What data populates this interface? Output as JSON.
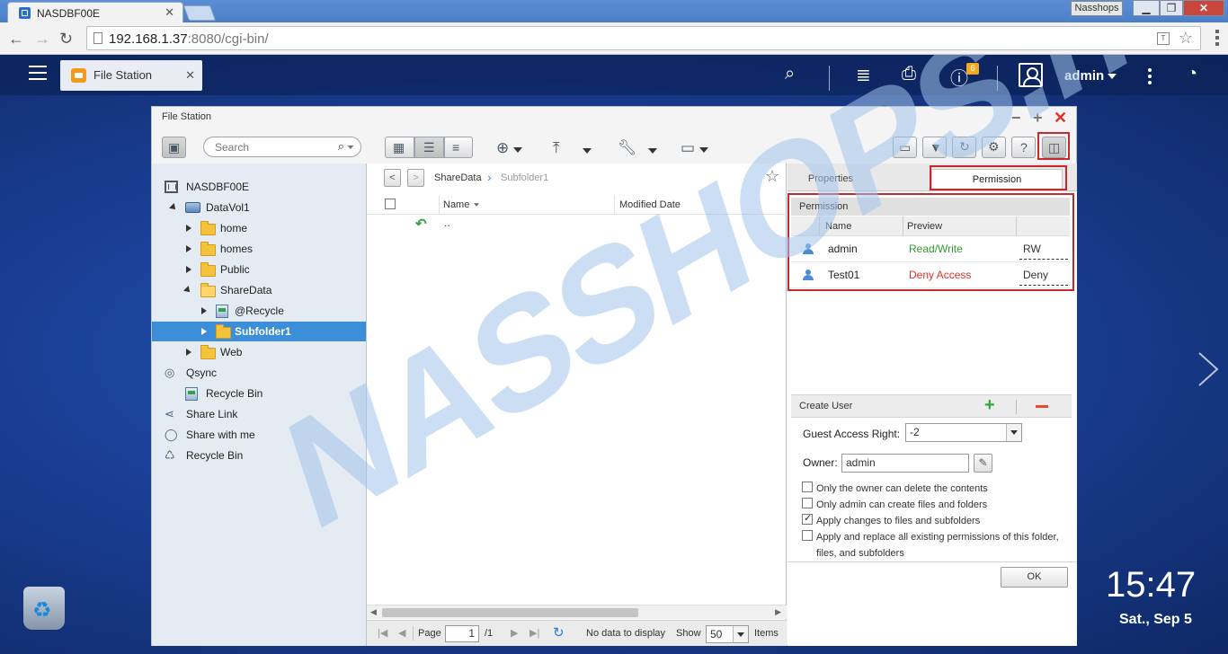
{
  "browser": {
    "tab_title": "NASDBF00E",
    "window_label": "Nasshops",
    "url_host": "192.168.1.37",
    "url_rest": ":8080/cgi-bin/"
  },
  "topbar": {
    "app_tab_label": "File Station",
    "notification_count": "6",
    "username": "admin"
  },
  "window": {
    "title": "File Station",
    "search_placeholder": "Search"
  },
  "tree": {
    "root": "NASDBF00E",
    "volume": "DataVol1",
    "folders": [
      "home",
      "homes",
      "Public",
      "ShareData"
    ],
    "sharedata_children": [
      "@Recycle",
      "Subfolder1"
    ],
    "web": "Web",
    "qsync": "Qsync",
    "qsync_recycle": "Recycle Bin",
    "share_link": "Share Link",
    "share_with_me": "Share with me",
    "recycle_bin": "Recycle Bin"
  },
  "filelist": {
    "breadcrumb": [
      "ShareData",
      "Subfolder1"
    ],
    "col_name": "Name",
    "col_modified": "Modified Date",
    "parent_entry": "..",
    "pager": {
      "page_label": "Page",
      "page_value": "1",
      "page_total": "/1",
      "status": "No data to display",
      "show_label": "Show",
      "show_value": "50",
      "items_label": "Items"
    }
  },
  "properties": {
    "tab_properties": "Properties",
    "tab_permission": "Permission",
    "section_title": "Permission",
    "col_name": "Name",
    "col_preview": "Preview",
    "rows": [
      {
        "name": "admin",
        "preview": "Read/Write",
        "right": "RW",
        "preview_color": "#2e9a2e"
      },
      {
        "name": "Test01",
        "preview": "Deny Access",
        "right": "Deny",
        "preview_color": "#e0302a"
      }
    ],
    "create_user": "Create User",
    "guest_label": "Guest Access Right:",
    "guest_value": "-2",
    "owner_label": "Owner:",
    "owner_value": "admin",
    "options": [
      {
        "label": "Only the owner can delete the contents",
        "checked": false
      },
      {
        "label": "Only admin can create files and folders",
        "checked": false
      },
      {
        "label": "Apply changes to files and subfolders",
        "checked": true
      },
      {
        "label": "Apply and replace all existing permissions of this folder, files, and subfolders",
        "checked": false
      }
    ],
    "ok_label": "OK"
  },
  "desktop": {
    "time": "15:47",
    "date": "Sat., Sep 5",
    "watermark": "NASSHOPS.net"
  },
  "colors": {
    "accent_red_box": "#c8282e",
    "selection_blue": "#3d8ed8"
  }
}
